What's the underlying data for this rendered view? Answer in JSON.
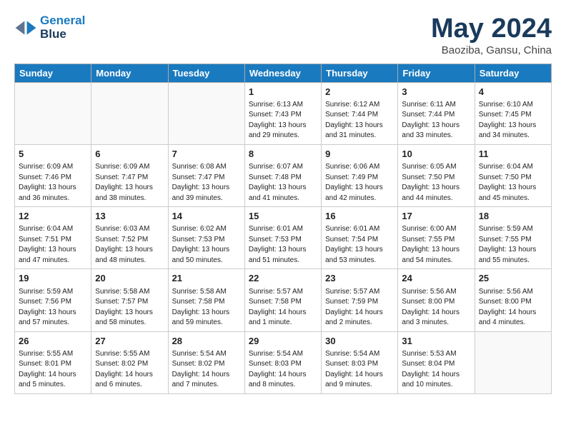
{
  "logo": {
    "line1": "General",
    "line2": "Blue"
  },
  "title": "May 2024",
  "subtitle": "Baoziba, Gansu, China",
  "weekdays": [
    "Sunday",
    "Monday",
    "Tuesday",
    "Wednesday",
    "Thursday",
    "Friday",
    "Saturday"
  ],
  "weeks": [
    [
      {
        "day": "",
        "info": ""
      },
      {
        "day": "",
        "info": ""
      },
      {
        "day": "",
        "info": ""
      },
      {
        "day": "1",
        "info": "Sunrise: 6:13 AM\nSunset: 7:43 PM\nDaylight: 13 hours\nand 29 minutes."
      },
      {
        "day": "2",
        "info": "Sunrise: 6:12 AM\nSunset: 7:44 PM\nDaylight: 13 hours\nand 31 minutes."
      },
      {
        "day": "3",
        "info": "Sunrise: 6:11 AM\nSunset: 7:44 PM\nDaylight: 13 hours\nand 33 minutes."
      },
      {
        "day": "4",
        "info": "Sunrise: 6:10 AM\nSunset: 7:45 PM\nDaylight: 13 hours\nand 34 minutes."
      }
    ],
    [
      {
        "day": "5",
        "info": "Sunrise: 6:09 AM\nSunset: 7:46 PM\nDaylight: 13 hours\nand 36 minutes."
      },
      {
        "day": "6",
        "info": "Sunrise: 6:09 AM\nSunset: 7:47 PM\nDaylight: 13 hours\nand 38 minutes."
      },
      {
        "day": "7",
        "info": "Sunrise: 6:08 AM\nSunset: 7:47 PM\nDaylight: 13 hours\nand 39 minutes."
      },
      {
        "day": "8",
        "info": "Sunrise: 6:07 AM\nSunset: 7:48 PM\nDaylight: 13 hours\nand 41 minutes."
      },
      {
        "day": "9",
        "info": "Sunrise: 6:06 AM\nSunset: 7:49 PM\nDaylight: 13 hours\nand 42 minutes."
      },
      {
        "day": "10",
        "info": "Sunrise: 6:05 AM\nSunset: 7:50 PM\nDaylight: 13 hours\nand 44 minutes."
      },
      {
        "day": "11",
        "info": "Sunrise: 6:04 AM\nSunset: 7:50 PM\nDaylight: 13 hours\nand 45 minutes."
      }
    ],
    [
      {
        "day": "12",
        "info": "Sunrise: 6:04 AM\nSunset: 7:51 PM\nDaylight: 13 hours\nand 47 minutes."
      },
      {
        "day": "13",
        "info": "Sunrise: 6:03 AM\nSunset: 7:52 PM\nDaylight: 13 hours\nand 48 minutes."
      },
      {
        "day": "14",
        "info": "Sunrise: 6:02 AM\nSunset: 7:53 PM\nDaylight: 13 hours\nand 50 minutes."
      },
      {
        "day": "15",
        "info": "Sunrise: 6:01 AM\nSunset: 7:53 PM\nDaylight: 13 hours\nand 51 minutes."
      },
      {
        "day": "16",
        "info": "Sunrise: 6:01 AM\nSunset: 7:54 PM\nDaylight: 13 hours\nand 53 minutes."
      },
      {
        "day": "17",
        "info": "Sunrise: 6:00 AM\nSunset: 7:55 PM\nDaylight: 13 hours\nand 54 minutes."
      },
      {
        "day": "18",
        "info": "Sunrise: 5:59 AM\nSunset: 7:55 PM\nDaylight: 13 hours\nand 55 minutes."
      }
    ],
    [
      {
        "day": "19",
        "info": "Sunrise: 5:59 AM\nSunset: 7:56 PM\nDaylight: 13 hours\nand 57 minutes."
      },
      {
        "day": "20",
        "info": "Sunrise: 5:58 AM\nSunset: 7:57 PM\nDaylight: 13 hours\nand 58 minutes."
      },
      {
        "day": "21",
        "info": "Sunrise: 5:58 AM\nSunset: 7:58 PM\nDaylight: 13 hours\nand 59 minutes."
      },
      {
        "day": "22",
        "info": "Sunrise: 5:57 AM\nSunset: 7:58 PM\nDaylight: 14 hours\nand 1 minute."
      },
      {
        "day": "23",
        "info": "Sunrise: 5:57 AM\nSunset: 7:59 PM\nDaylight: 14 hours\nand 2 minutes."
      },
      {
        "day": "24",
        "info": "Sunrise: 5:56 AM\nSunset: 8:00 PM\nDaylight: 14 hours\nand 3 minutes."
      },
      {
        "day": "25",
        "info": "Sunrise: 5:56 AM\nSunset: 8:00 PM\nDaylight: 14 hours\nand 4 minutes."
      }
    ],
    [
      {
        "day": "26",
        "info": "Sunrise: 5:55 AM\nSunset: 8:01 PM\nDaylight: 14 hours\nand 5 minutes."
      },
      {
        "day": "27",
        "info": "Sunrise: 5:55 AM\nSunset: 8:02 PM\nDaylight: 14 hours\nand 6 minutes."
      },
      {
        "day": "28",
        "info": "Sunrise: 5:54 AM\nSunset: 8:02 PM\nDaylight: 14 hours\nand 7 minutes."
      },
      {
        "day": "29",
        "info": "Sunrise: 5:54 AM\nSunset: 8:03 PM\nDaylight: 14 hours\nand 8 minutes."
      },
      {
        "day": "30",
        "info": "Sunrise: 5:54 AM\nSunset: 8:03 PM\nDaylight: 14 hours\nand 9 minutes."
      },
      {
        "day": "31",
        "info": "Sunrise: 5:53 AM\nSunset: 8:04 PM\nDaylight: 14 hours\nand 10 minutes."
      },
      {
        "day": "",
        "info": ""
      }
    ]
  ]
}
